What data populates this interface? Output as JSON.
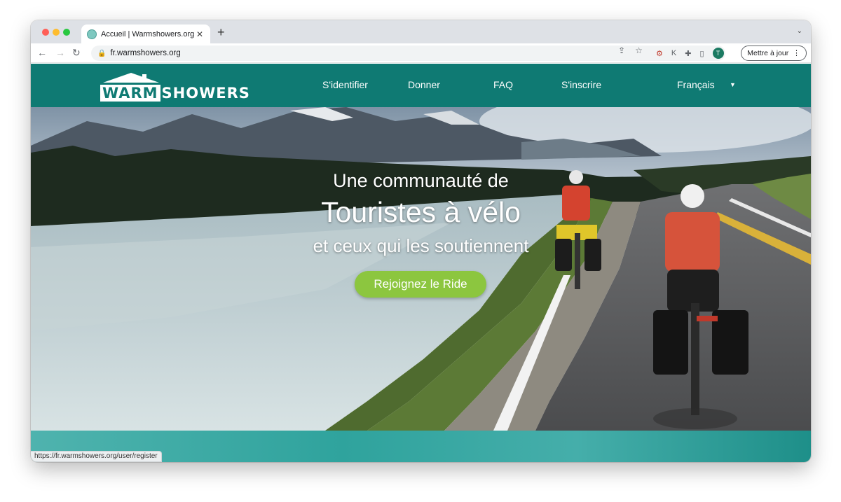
{
  "browser": {
    "tab_title": "Accueil | Warmshowers.org",
    "url": "fr.warmshowers.org",
    "update_button": "Mettre à jour",
    "avatar_letter": "T",
    "status_url": "https://fr.warmshowers.org/user/register"
  },
  "site": {
    "logo_warm": "WARM",
    "logo_showers": "SHOWERS",
    "nav": [
      "S'identifier",
      "Donner",
      "FAQ",
      "S'inscrire"
    ],
    "language": "Français"
  },
  "hero": {
    "line1": "Une communauté de",
    "line2": "Touristes à vélo",
    "line3": "et ceux qui les soutiennent",
    "cta": "Rejoignez le Ride"
  },
  "colors": {
    "header": "#0f7a73",
    "cta": "#8cc63f"
  }
}
